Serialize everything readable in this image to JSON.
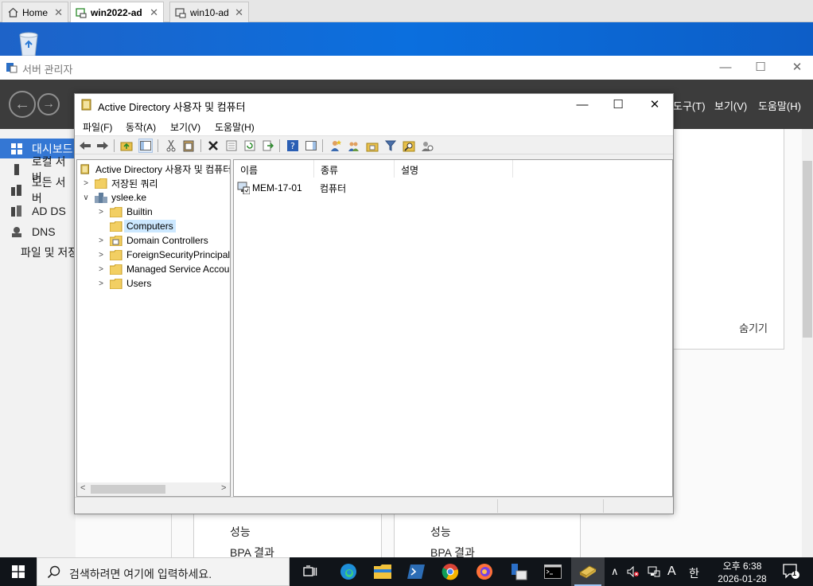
{
  "vm_tabs": [
    {
      "label": "Home",
      "active": false
    },
    {
      "label": "win2022-ad",
      "active": true
    },
    {
      "label": "win10-ad",
      "active": false
    }
  ],
  "server_manager": {
    "title": "서버 관리자",
    "menus": [
      "도구(T)",
      "보기(V)",
      "도움말(H)"
    ],
    "sidebar": [
      {
        "label": "대시보드",
        "active": true
      },
      {
        "label": "로컬 서버"
      },
      {
        "label": "모든 서버"
      },
      {
        "label": "AD DS"
      },
      {
        "label": "DNS"
      },
      {
        "label": "파일 및 저장소 서비스"
      }
    ],
    "hide_label": "숨기기",
    "tiles": [
      {
        "perf": "성능",
        "bpa": "BPA 결과"
      },
      {
        "perf": "성능",
        "bpa": "BPA 결과"
      }
    ]
  },
  "aduc": {
    "title": "Active Directory 사용자 및 컴퓨터",
    "menu": [
      "파일(F)",
      "동작(A)",
      "보기(V)",
      "도움말(H)"
    ],
    "tree": {
      "root": "Active Directory 사용자 및 컴퓨터",
      "saved_queries": "저장된 쿼리",
      "domain": "yslee.ke",
      "children": [
        "Builtin",
        "Computers",
        "Domain Controllers",
        "ForeignSecurityPrincipals",
        "Managed Service Accounts",
        "Users"
      ],
      "selected": "Computers"
    },
    "columns": [
      "이름",
      "종류",
      "설명"
    ],
    "rows": [
      {
        "name": "MEM-17-01",
        "type": "컴퓨터",
        "desc": ""
      }
    ]
  },
  "taskbar": {
    "search_placeholder": "검색하려면 여기에 입력하세요.",
    "ime_mode": "A",
    "ime_lang": "한",
    "time": "오후 6:38",
    "date": "2026-01-28",
    "notification_count": "1"
  },
  "colors": {
    "desktop_blue": "#0b6fde",
    "sm_bar": "#3c3c3c",
    "sidebar_active": "#3477d4",
    "selection": "#cce8ff",
    "taskbar": "#101419"
  }
}
